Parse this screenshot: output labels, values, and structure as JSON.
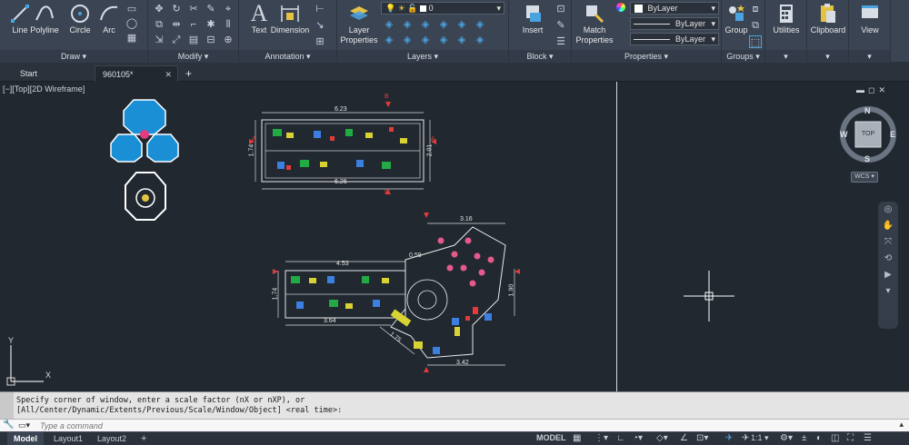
{
  "ribbon": {
    "draw": {
      "title": "Draw",
      "tools": [
        {
          "label": "Line",
          "icon": "line-icon"
        },
        {
          "label": "Polyline",
          "icon": "polyline-icon"
        },
        {
          "label": "Circle",
          "icon": "circle-icon"
        },
        {
          "label": "Arc",
          "icon": "arc-icon"
        }
      ]
    },
    "modify": {
      "title": "Modify"
    },
    "annotation": {
      "title": "Annotation",
      "tools": [
        {
          "label": "Text",
          "icon": "text-icon"
        },
        {
          "label": "Dimension",
          "icon": "dimension-icon"
        }
      ]
    },
    "layers": {
      "title": "Layers",
      "layer_properties_label": "Layer Properties",
      "current_layer": "0"
    },
    "block": {
      "title": "Block",
      "insert_label": "Insert"
    },
    "properties": {
      "title": "Properties",
      "match_label": "Match Properties",
      "color": "ByLayer",
      "linetype": "ByLayer",
      "lineweight": "ByLayer"
    },
    "groups": {
      "title": "Groups",
      "group_label": "Group"
    },
    "utilities": {
      "label": "Utilities"
    },
    "clipboard": {
      "label": "Clipboard"
    },
    "view": {
      "label": "View"
    }
  },
  "tabs": {
    "start": "Start",
    "document": "960105*"
  },
  "canvas": {
    "viewport_label": "[−][Top][2D Wireframe]",
    "viewcube_top": "TOP",
    "compass": {
      "n": "N",
      "s": "S",
      "e": "E",
      "w": "W"
    },
    "wcs_label": "WCS",
    "dimensions": {
      "plan1_top": "6.23",
      "plan1_bottom": "6.26",
      "plan1_left": "1.74",
      "plan1_right": "2.01",
      "plan2_top_left": "4.53",
      "plan2_bottom": "3.64",
      "plan2_left": "1.74",
      "plan2_top_right": "3.16",
      "plan2_small": "0.59",
      "plan2_bottom_right": "3.42",
      "plan2_diag": "1.75",
      "plan2_right": "1.90"
    },
    "section_markers": {
      "a": "A",
      "b": "B"
    },
    "ucs": {
      "x": "X",
      "y": "Y"
    }
  },
  "command": {
    "history_line1": "Specify corner of window, enter a scale factor (nX or nXP), or",
    "history_line2": "[All/Center/Dynamic/Extents/Previous/Scale/Window/Object] <real time>:",
    "placeholder": "Type a command"
  },
  "status": {
    "layouts": [
      "Model",
      "Layout1",
      "Layout2"
    ],
    "space": "MODEL",
    "scale": "1:1"
  },
  "colors": {
    "ribbon_bg": "#3b4453",
    "canvas_bg": "#212830",
    "command_bg": "#e4e4e4",
    "accent": "#4aa3df"
  }
}
